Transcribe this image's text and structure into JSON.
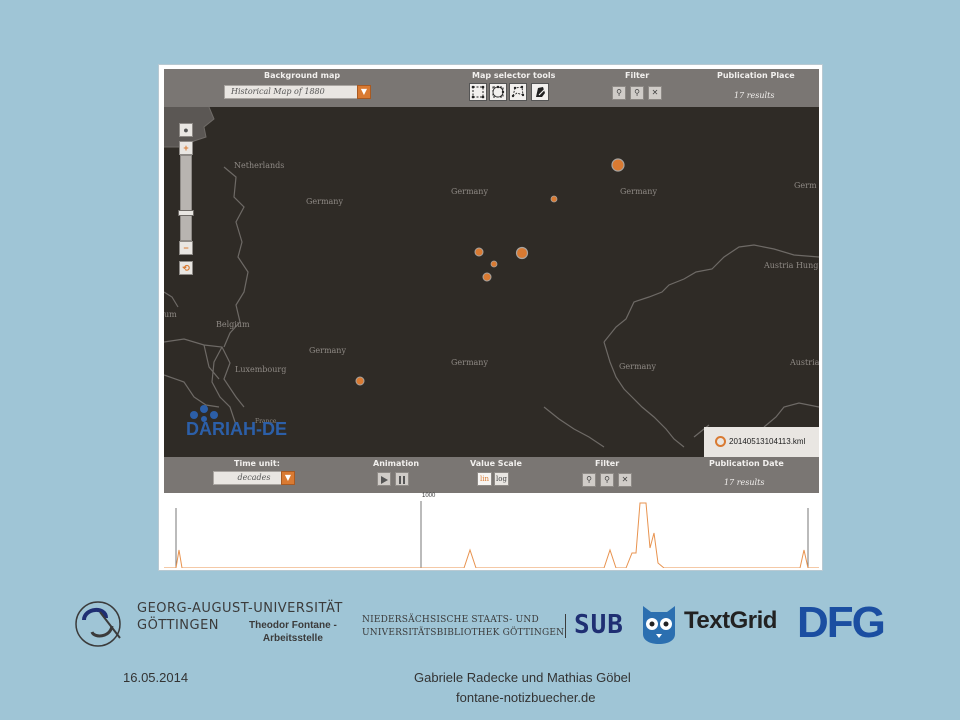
{
  "top_toolbar": {
    "background_map_label": "Background map",
    "background_map_value": "Historical Map of 1880",
    "map_selector_label": "Map selector tools",
    "filter_label": "Filter",
    "publication_place_label": "Publication Place",
    "publication_place_results": "17 results"
  },
  "map": {
    "labels": [
      "Netherlands",
      "Germany",
      "Germany",
      "Germany",
      "Germ",
      "Austria Hung",
      "um",
      "Belgium",
      "Germany",
      "Germany",
      "Germany",
      "Luxembourg",
      "Austria",
      "France"
    ],
    "dariah_logo_text": "DARIAH-DE",
    "legend_file": "20140513104113.kml",
    "marker_color": "#d97a32"
  },
  "bottom_toolbar": {
    "time_unit_label": "Time unit:",
    "time_unit_value": "decades",
    "animation_label": "Animation",
    "value_scale_label": "Value Scale",
    "scale_lin": "lin",
    "scale_log": "log",
    "filter_label": "Filter",
    "publication_date_label": "Publication Date",
    "publication_date_results": "17 results"
  },
  "timeline": {
    "tick_label": "1000"
  },
  "footer": {
    "university_line1": "GEORG-AUGUST-UNIVERSITÄT",
    "university_line2": "GÖTTINGEN",
    "fontane_line1": "Theodor Fontane -",
    "fontane_line2": "Arbeitsstelle",
    "sub_line1": "NIEDERSÄCHSISCHE STAATS- UND",
    "sub_line2": "UNIVERSITÄTSBIBLIOTHEK GÖTTINGEN",
    "sub_short": "SUB",
    "textgrid": "TextGrid",
    "dfg": "DFG",
    "date": "16.05.2014",
    "authors": "Gabriele Radecke und  Mathias Göbel",
    "website": "fontane-notizbuecher.de"
  },
  "colors": {
    "slide_background": "#9fc5d6",
    "toolbar": "#7a7673",
    "map_background": "#2f2b26",
    "accent": "#d97a32"
  }
}
